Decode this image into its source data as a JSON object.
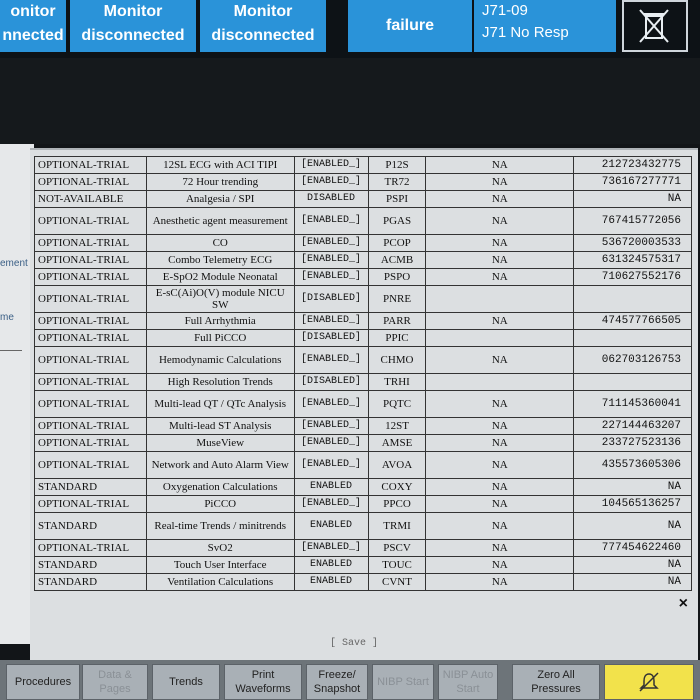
{
  "topbar": {
    "tiles": [
      {
        "l1": "onitor",
        "l2": "nnected"
      },
      {
        "l1": "Monitor",
        "l2": "disconnected"
      },
      {
        "l1": "Monitor",
        "l2": "disconnected"
      },
      {
        "l1": "failure"
      },
      {
        "l1": "J71-09",
        "l2": "J71 No Resp"
      }
    ],
    "icon": "crossed-bin-icon"
  },
  "side": {
    "label1": "ement",
    "label2": "me"
  },
  "table": {
    "rows": [
      [
        "OPTIONAL-TRIAL",
        "12SL ECG with ACI TIPI",
        "[ENABLED_]",
        "P12S",
        "NA",
        "212723432775"
      ],
      [
        "OPTIONAL-TRIAL",
        "72 Hour trending",
        "[ENABLED_]",
        "TR72",
        "NA",
        "736167277771"
      ],
      [
        "NOT-AVAILABLE",
        "Analgesia / SPI",
        "DISABLED",
        "PSPI",
        "NA",
        "NA"
      ],
      [
        "OPTIONAL-TRIAL",
        "Anesthetic agent measurement",
        "[ENABLED_]",
        "PGAS",
        "NA",
        "767415772056"
      ],
      [
        "OPTIONAL-TRIAL",
        "CO",
        "[ENABLED_]",
        "PCOP",
        "NA",
        "536720003533"
      ],
      [
        "OPTIONAL-TRIAL",
        "Combo Telemetry ECG",
        "[ENABLED_]",
        "ACMB",
        "NA",
        "631324575317"
      ],
      [
        "OPTIONAL-TRIAL",
        "E-SpO2 Module Neonatal",
        "[ENABLED_]",
        "PSPO",
        "NA",
        "710627552176"
      ],
      [
        "OPTIONAL-TRIAL",
        "E-sC(Ai)O(V) module NICU SW",
        "[DISABLED]",
        "PNRE",
        "",
        ""
      ],
      [
        "OPTIONAL-TRIAL",
        "Full Arrhythmia",
        "[ENABLED_]",
        "PARR",
        "NA",
        "474577766505"
      ],
      [
        "OPTIONAL-TRIAL",
        "Full PiCCO",
        "[DISABLED]",
        "PPIC",
        "",
        ""
      ],
      [
        "OPTIONAL-TRIAL",
        "Hemodynamic Calculations",
        "[ENABLED_]",
        "CHMO",
        "NA",
        "062703126753"
      ],
      [
        "OPTIONAL-TRIAL",
        "High Resolution Trends",
        "[DISABLED]",
        "TRHI",
        "",
        ""
      ],
      [
        "OPTIONAL-TRIAL",
        "Multi-lead QT / QTc Analysis",
        "[ENABLED_]",
        "PQTC",
        "NA",
        "711145360041"
      ],
      [
        "OPTIONAL-TRIAL",
        "Multi-lead ST Analysis",
        "[ENABLED_]",
        "12ST",
        "NA",
        "227144463207"
      ],
      [
        "OPTIONAL-TRIAL",
        "MuseView",
        "[ENABLED_]",
        "AMSE",
        "NA",
        "233727523136"
      ],
      [
        "OPTIONAL-TRIAL",
        "Network and Auto Alarm View",
        "[ENABLED_]",
        "AVOA",
        "NA",
        "435573605306"
      ],
      [
        "STANDARD",
        "Oxygenation Calculations",
        "ENABLED",
        "COXY",
        "NA",
        "NA"
      ],
      [
        "OPTIONAL-TRIAL",
        "PiCCO",
        "[ENABLED_]",
        "PPCO",
        "NA",
        "104565136257"
      ],
      [
        "STANDARD",
        "Real-time Trends / minitrends",
        "ENABLED",
        "TRMI",
        "NA",
        "NA"
      ],
      [
        "OPTIONAL-TRIAL",
        "SvO2",
        "[ENABLED_]",
        "PSCV",
        "NA",
        "777454622460"
      ],
      [
        "STANDARD",
        "Touch User Interface",
        "ENABLED",
        "TOUC",
        "NA",
        "NA"
      ],
      [
        "STANDARD",
        "Ventilation Calculations",
        "ENABLED",
        "CVNT",
        "NA",
        "NA"
      ]
    ],
    "tall_rows": [
      3,
      7,
      10,
      12,
      15,
      18
    ]
  },
  "save_label": "[ Save ]",
  "close_label": "×",
  "bottom": {
    "buttons": [
      {
        "label": "Procedures",
        "dim": false
      },
      {
        "label": "Data & Pages",
        "dim": true
      },
      {
        "label": "Trends",
        "dim": false
      },
      {
        "label": "Print Waveforms",
        "dim": false
      },
      {
        "label": "Freeze/ Snapshot",
        "dim": false
      },
      {
        "label": "NIBP Start",
        "dim": true
      },
      {
        "label": "NIBP Auto Start",
        "dim": true
      },
      {
        "label": "Zero All Pressures",
        "dim": false
      },
      {
        "label": "",
        "dim": false,
        "icon": "alarm-bell-icon"
      }
    ]
  }
}
